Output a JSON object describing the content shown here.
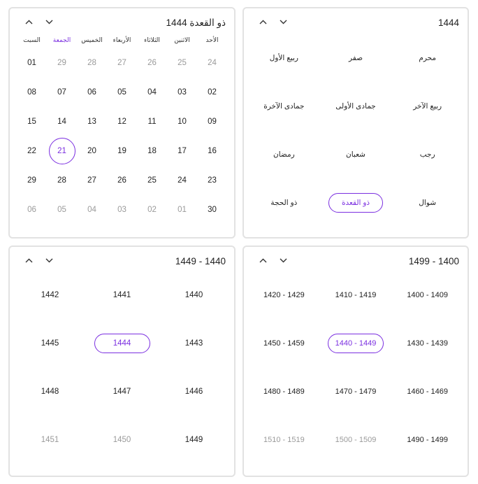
{
  "day_view": {
    "title": "ذو القعدة 1444",
    "weekdays": [
      {
        "label": "الأحد",
        "selected": false
      },
      {
        "label": "الاثنين",
        "selected": false
      },
      {
        "label": "الثلاثاء",
        "selected": false
      },
      {
        "label": "الأربعاء",
        "selected": false
      },
      {
        "label": "الخميس",
        "selected": false
      },
      {
        "label": "الجمعة",
        "selected": true
      },
      {
        "label": "السبت",
        "selected": false
      }
    ],
    "days": [
      {
        "t": "24",
        "dim": true
      },
      {
        "t": "25",
        "dim": true
      },
      {
        "t": "26",
        "dim": true
      },
      {
        "t": "27",
        "dim": true
      },
      {
        "t": "28",
        "dim": true
      },
      {
        "t": "29",
        "dim": true
      },
      {
        "t": "01"
      },
      {
        "t": "02"
      },
      {
        "t": "03"
      },
      {
        "t": "04"
      },
      {
        "t": "05"
      },
      {
        "t": "06"
      },
      {
        "t": "07"
      },
      {
        "t": "08"
      },
      {
        "t": "09"
      },
      {
        "t": "10"
      },
      {
        "t": "11"
      },
      {
        "t": "12"
      },
      {
        "t": "13"
      },
      {
        "t": "14"
      },
      {
        "t": "15"
      },
      {
        "t": "16"
      },
      {
        "t": "17"
      },
      {
        "t": "18"
      },
      {
        "t": "19"
      },
      {
        "t": "20"
      },
      {
        "t": "21",
        "selected": true
      },
      {
        "t": "22"
      },
      {
        "t": "23"
      },
      {
        "t": "24"
      },
      {
        "t": "25"
      },
      {
        "t": "26"
      },
      {
        "t": "27"
      },
      {
        "t": "28"
      },
      {
        "t": "29"
      },
      {
        "t": "30"
      },
      {
        "t": "01",
        "dim": true
      },
      {
        "t": "02",
        "dim": true
      },
      {
        "t": "03",
        "dim": true
      },
      {
        "t": "04",
        "dim": true
      },
      {
        "t": "05",
        "dim": true
      },
      {
        "t": "06",
        "dim": true
      }
    ]
  },
  "month_view": {
    "title": "1444",
    "months": [
      {
        "t": "محرم"
      },
      {
        "t": "صفر"
      },
      {
        "t": "ربيع الأول"
      },
      {
        "t": "ربيع الآخر"
      },
      {
        "t": "جمادى الأولى"
      },
      {
        "t": "جمادى الآخرة"
      },
      {
        "t": "رجب"
      },
      {
        "t": "شعبان"
      },
      {
        "t": "رمضان"
      },
      {
        "t": "شوال"
      },
      {
        "t": "ذو القعدة",
        "selected": true
      },
      {
        "t": "ذو الحجة"
      }
    ]
  },
  "year_view": {
    "title": "1440 - 1449",
    "years": [
      {
        "t": "1440"
      },
      {
        "t": "1441"
      },
      {
        "t": "1442"
      },
      {
        "t": "1443"
      },
      {
        "t": "1444",
        "selected": true
      },
      {
        "t": "1445"
      },
      {
        "t": "1446"
      },
      {
        "t": "1447"
      },
      {
        "t": "1448"
      },
      {
        "t": "1449"
      },
      {
        "t": "1450",
        "dim": true
      },
      {
        "t": "1451",
        "dim": true
      }
    ]
  },
  "decade_view": {
    "title": "1400 - 1499",
    "decades": [
      {
        "t": "1400 - 1409"
      },
      {
        "t": "1410 - 1419"
      },
      {
        "t": "1420 - 1429"
      },
      {
        "t": "1430 - 1439"
      },
      {
        "t": "1440 - 1449",
        "selected": true
      },
      {
        "t": "1450 - 1459"
      },
      {
        "t": "1460 - 1469"
      },
      {
        "t": "1470 - 1479"
      },
      {
        "t": "1480 - 1489"
      },
      {
        "t": "1490 - 1499"
      },
      {
        "t": "1500 - 1509",
        "dim": true
      },
      {
        "t": "1510 - 1519",
        "dim": true
      }
    ]
  },
  "colors": {
    "accent": "#7b2fe0",
    "dim": "#9a9a9a",
    "border": "#e2e2e2"
  },
  "icons": {
    "up": "chevron-up-icon",
    "down": "chevron-down-icon"
  }
}
